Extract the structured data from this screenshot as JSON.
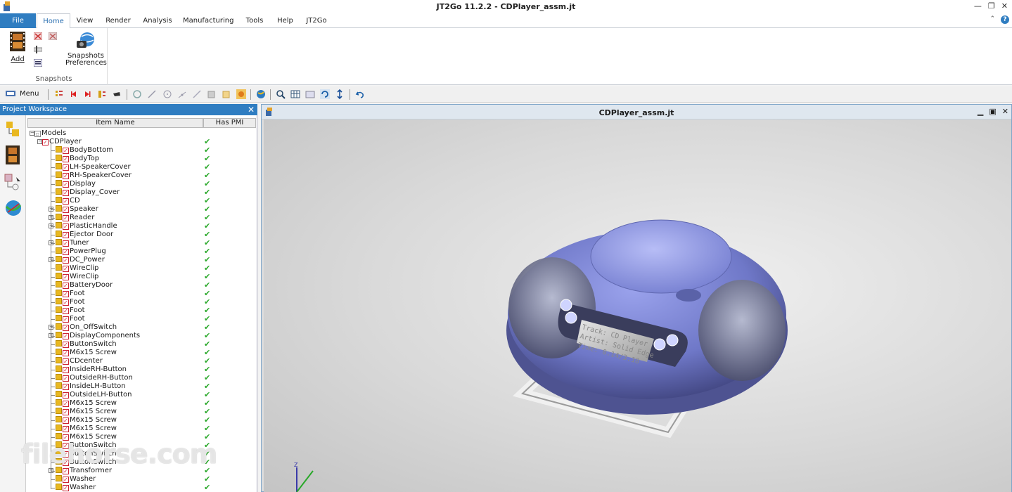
{
  "window": {
    "title": "JT2Go 11.2.2 - CDPlayer_assm.jt",
    "minimize_icon": "minimize-icon",
    "restore_icon": "restore-icon",
    "close_icon": "close-icon"
  },
  "tabs": [
    {
      "label": "File"
    },
    {
      "label": "Home"
    },
    {
      "label": "View"
    },
    {
      "label": "Render"
    },
    {
      "label": "Analysis"
    },
    {
      "label": "Manufacturing"
    },
    {
      "label": "Tools"
    },
    {
      "label": "Help"
    },
    {
      "label": "JT2Go"
    }
  ],
  "active_tab": "Home",
  "ribbon": {
    "group_label": "Snapshots",
    "add_label": "Add",
    "snapshots_prefs_line1": "Snapshots",
    "snapshots_prefs_line2": "Preferences"
  },
  "toolbar": {
    "menu_label": "Menu"
  },
  "workspace": {
    "title": "Project Workspace",
    "col_item_name": "Item Name",
    "col_has_pmi": "Has PMI",
    "root": "Models",
    "assembly": "CDPlayer",
    "items": [
      {
        "name": "BodyBottom",
        "exp": false
      },
      {
        "name": "BodyTop",
        "exp": false
      },
      {
        "name": "LH-SpeakerCover",
        "exp": false
      },
      {
        "name": "RH-SpeakerCover",
        "exp": false
      },
      {
        "name": "Display",
        "exp": false
      },
      {
        "name": "Display_Cover",
        "exp": false
      },
      {
        "name": "CD",
        "exp": false
      },
      {
        "name": "Speaker",
        "exp": true
      },
      {
        "name": "Reader",
        "exp": true
      },
      {
        "name": "PlasticHandle",
        "exp": true
      },
      {
        "name": "Ejector Door",
        "exp": false
      },
      {
        "name": "Tuner",
        "exp": true
      },
      {
        "name": "PowerPlug",
        "exp": false
      },
      {
        "name": "DC_Power",
        "exp": true
      },
      {
        "name": "WireClip",
        "exp": false
      },
      {
        "name": "WireClip",
        "exp": false
      },
      {
        "name": "BatteryDoor",
        "exp": false
      },
      {
        "name": "Foot",
        "exp": false
      },
      {
        "name": "Foot",
        "exp": false
      },
      {
        "name": "Foot",
        "exp": false
      },
      {
        "name": "Foot",
        "exp": false
      },
      {
        "name": "On_OffSwitch",
        "exp": true
      },
      {
        "name": "DisplayComponents",
        "exp": true
      },
      {
        "name": "ButtonSwitch",
        "exp": false
      },
      {
        "name": "M6x15 Screw",
        "exp": false
      },
      {
        "name": "CDcenter",
        "exp": false
      },
      {
        "name": "InsideRH-Button",
        "exp": false
      },
      {
        "name": "OutsideRH-Button",
        "exp": false
      },
      {
        "name": "InsideLH-Button",
        "exp": false
      },
      {
        "name": "OutsideLH-Button",
        "exp": false
      },
      {
        "name": "M6x15 Screw",
        "exp": false
      },
      {
        "name": "M6x15 Screw",
        "exp": false
      },
      {
        "name": "M6x15 Screw",
        "exp": false
      },
      {
        "name": "M6x15 Screw",
        "exp": false
      },
      {
        "name": "M6x15 Screw",
        "exp": false
      },
      {
        "name": "ButtonSwitch",
        "exp": false
      },
      {
        "name": "ButtonSwitch",
        "exp": false
      },
      {
        "name": "ButtonSwitch",
        "exp": false
      },
      {
        "name": "Transformer",
        "exp": true
      },
      {
        "name": "Washer",
        "exp": false
      },
      {
        "name": "Washer",
        "exp": false
      }
    ],
    "pmi_mark": "✔"
  },
  "viewport": {
    "title": "CDPlayer_assm.jt",
    "display_text_line1": "Track: CD Player",
    "display_text_line2": "Artist: Solid Edge",
    "display_text_line3": "Time: 0.14/3.18",
    "body_color": "#6f78c8",
    "body_dark": "#5a5f9c"
  },
  "watermark": "filehorse.com"
}
